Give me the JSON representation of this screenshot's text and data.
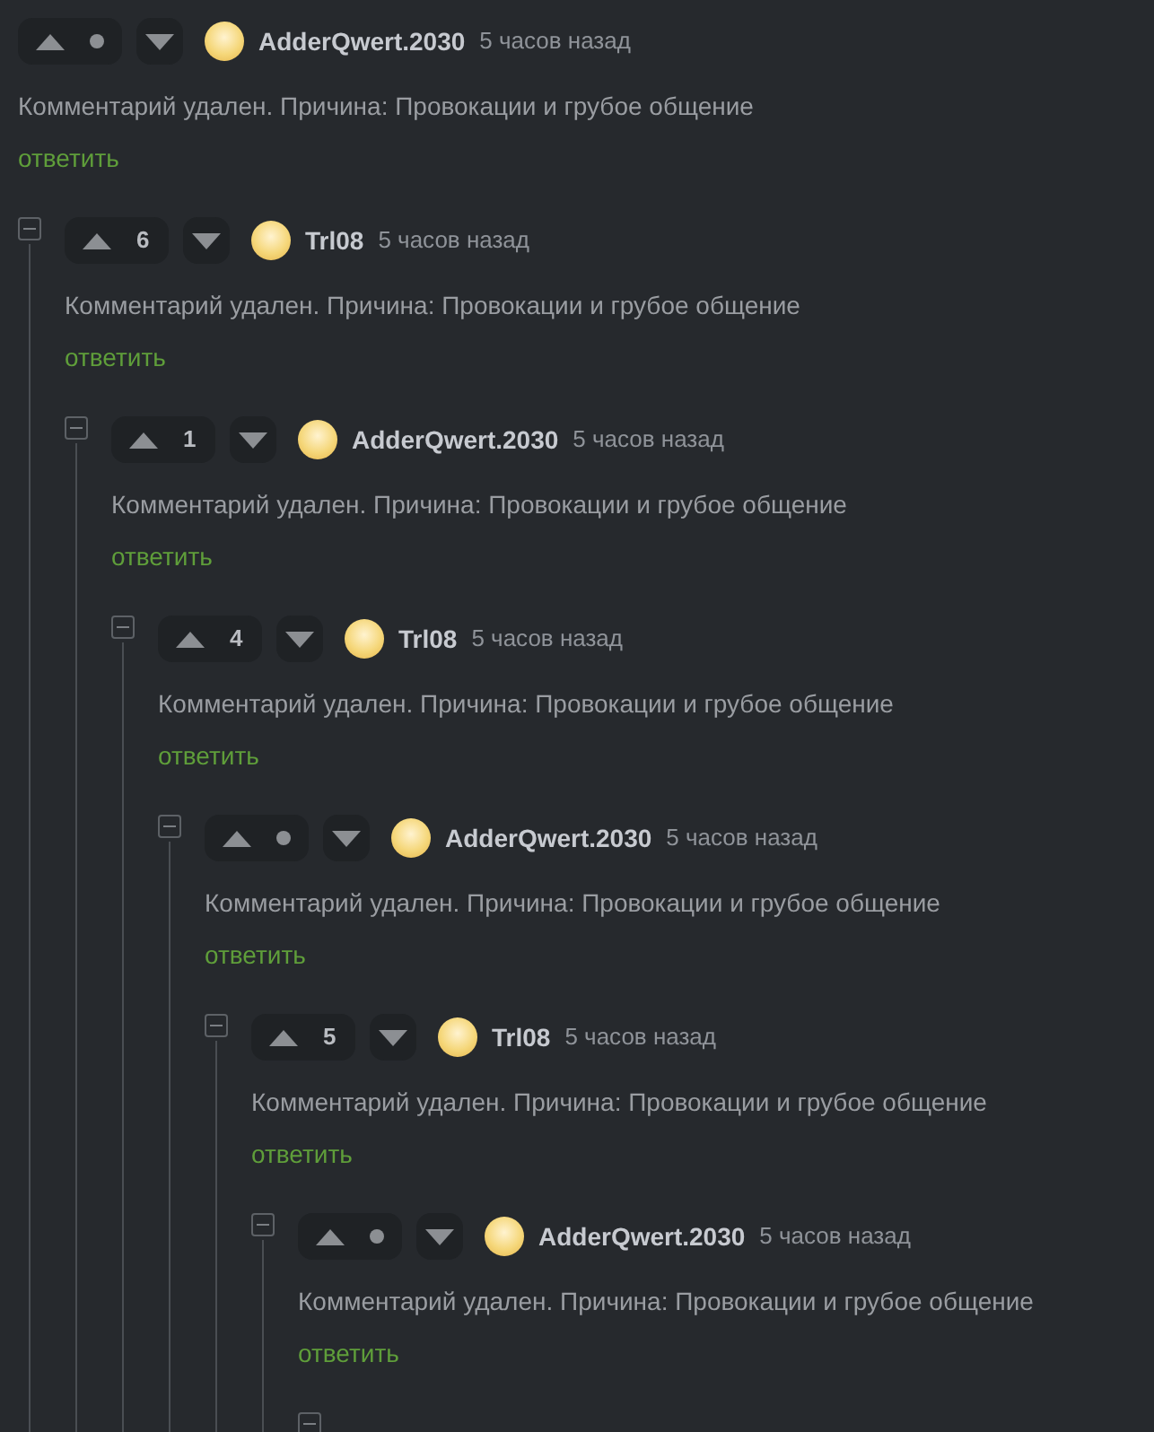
{
  "thread": {
    "author": "AdderQwert.2030",
    "time": "5 часов назад",
    "text": "Комментарий удален. Причина: Провокации и грубое общение",
    "reply": "ответить",
    "children": [
      {
        "author": "Trl08",
        "time": "5 часов назад",
        "score": "6",
        "text": "Комментарий удален. Причина: Провокации и грубое общение",
        "reply": "ответить",
        "children": [
          {
            "author": "AdderQwert.2030",
            "time": "5 часов назад",
            "score": "1",
            "text": "Комментарий удален. Причина: Провокации и грубое общение",
            "reply": "ответить",
            "children": [
              {
                "author": "Trl08",
                "time": "5 часов назад",
                "score": "4",
                "text": "Комментарий удален. Причина: Провокации и грубое общение",
                "reply": "ответить",
                "children": [
                  {
                    "author": "AdderQwert.2030",
                    "time": "5 часов назад",
                    "text": "Комментарий удален. Причина: Провокации и грубое общение",
                    "reply": "ответить",
                    "children": [
                      {
                        "author": "Trl08",
                        "time": "5 часов назад",
                        "score": "5",
                        "text": "Комментарий удален. Причина: Провокации и грубое общение",
                        "reply": "ответить",
                        "children": [
                          {
                            "author": "AdderQwert.2030",
                            "time": "5 часов назад",
                            "text": "Комментарий удален. Причина: Провокации и грубое общение",
                            "reply": "ответить",
                            "more_replies": true
                          }
                        ]
                      }
                    ]
                  }
                ]
              }
            ]
          }
        ]
      }
    ]
  }
}
